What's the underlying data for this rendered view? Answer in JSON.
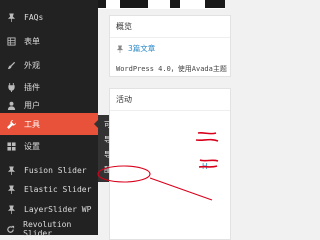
{
  "menu": {
    "faqs": "FAQs",
    "forms": "表单",
    "appearance": "外观",
    "plugins": "插件",
    "users": "用户",
    "tools": "工具",
    "settings": "设置",
    "fusion_slider": "Fusion Slider",
    "elastic_slider": "Elastic Slider",
    "layerslider": "LayerSlider WP",
    "revolution_slider": "Revolution Slider"
  },
  "tools_flyout": {
    "available_tools": "可用工具",
    "import": "导入",
    "export": "导出",
    "config_file": "配置网站"
  },
  "overview": {
    "title": "概览",
    "posts": "3篇文章",
    "wp_text": "WordPress 4.0，使用Avada主题"
  },
  "activity": {
    "title": "活动",
    "link_fragment": "H"
  },
  "colors": {
    "sidebar_bg": "#222222",
    "active_bg": "#e8523a",
    "flyout_bg": "#333333",
    "annotation_red": "#d9001b",
    "link_blue": "#2b8ac6"
  }
}
